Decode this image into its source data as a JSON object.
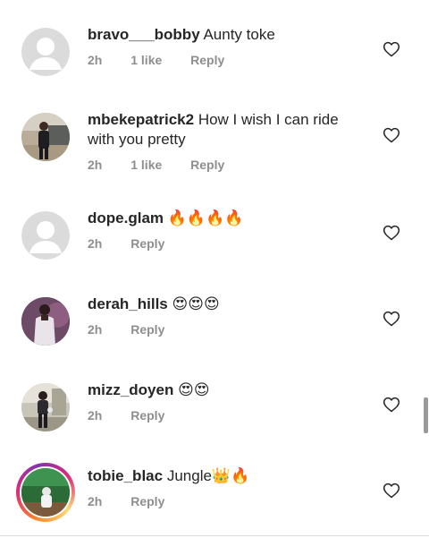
{
  "comments": [
    {
      "username": "bravo___bobby",
      "text": "Aunty toke",
      "time": "2h",
      "likes": "1 like",
      "reply": "Reply",
      "avatar": "default-avatar"
    },
    {
      "username": "mbekepatrick2",
      "text": "How I wish I can ride with you pretty",
      "time": "2h",
      "likes": "1 like",
      "reply": "Reply",
      "avatar": "photo-avatar"
    },
    {
      "username": "dope.glam",
      "text": "🔥🔥🔥🔥",
      "time": "2h",
      "reply": "Reply",
      "avatar": "default-avatar"
    },
    {
      "username": "derah_hills",
      "text": "😍😍😍",
      "time": "2h",
      "reply": "Reply",
      "avatar": "photo-avatar"
    },
    {
      "username": "mizz_doyen",
      "text": "😍😍",
      "time": "2h",
      "reply": "Reply",
      "avatar": "photo-avatar"
    },
    {
      "username": "tobie_blac",
      "text": "Jungle👑🔥",
      "time": "2h",
      "reply": "Reply",
      "avatar": "story-ring-avatar"
    }
  ],
  "colors": {
    "text": "#262626",
    "secondary": "#8e8e8e",
    "default_avatar_bg": "#dbdbdb"
  }
}
